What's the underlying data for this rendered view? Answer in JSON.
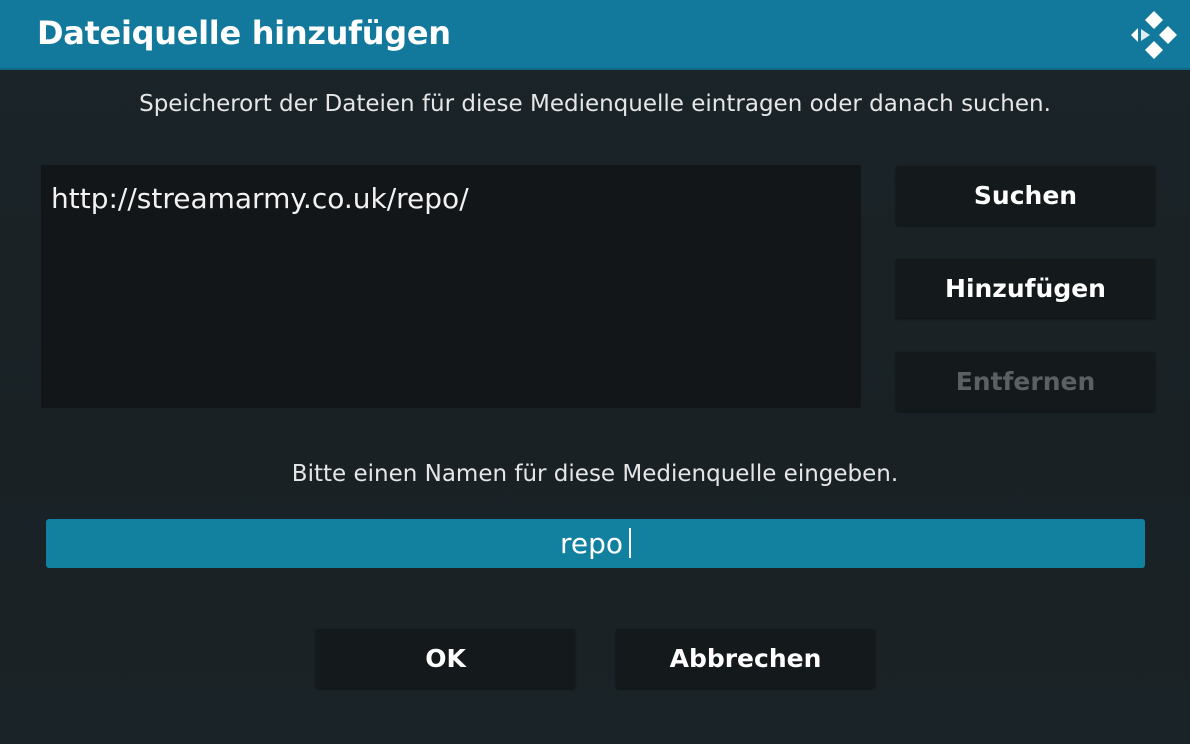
{
  "dialog": {
    "title": "Dateiquelle hinzufügen",
    "logo_icon": "kodi-logo-icon",
    "colors": {
      "header": "#12799d",
      "input_active": "#12809f",
      "background": "#1a2226",
      "disabled_text": "#5b6163"
    }
  },
  "source": {
    "prompt": "Speicherort der Dateien für diese Medienquelle eintragen oder danach suchen.",
    "items": [
      "http://streamarmy.co.uk/repo/"
    ]
  },
  "side_buttons": {
    "browse_label": "Suchen",
    "add_label": "Hinzufügen",
    "remove_label": "Entfernen"
  },
  "name": {
    "prompt": "Bitte einen Namen für diese Medienquelle eingeben.",
    "value": "repo"
  },
  "actions": {
    "ok_label": "OK",
    "cancel_label": "Abbrechen"
  }
}
